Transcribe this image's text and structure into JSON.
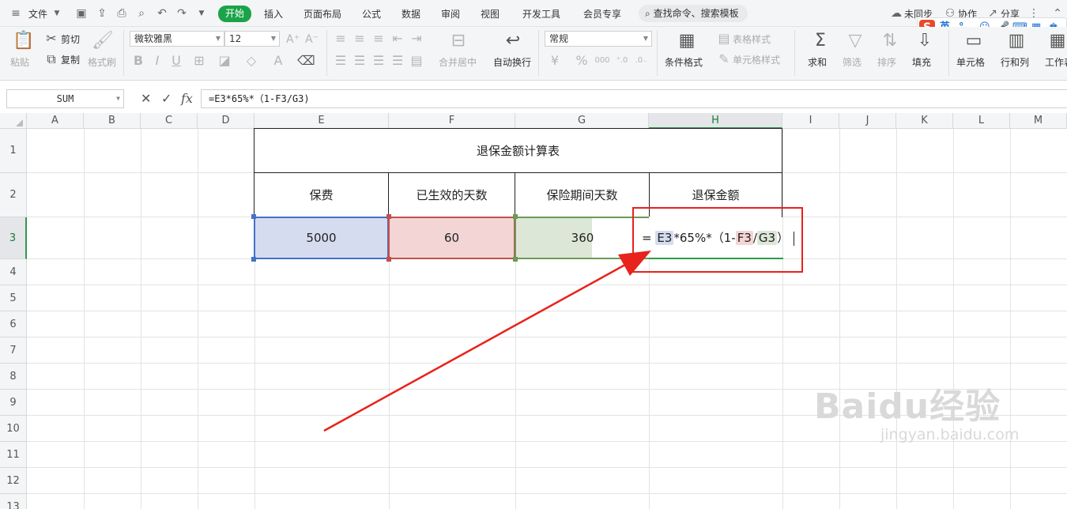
{
  "menu": {
    "file": "文件",
    "tabs": [
      "开始",
      "插入",
      "页面布局",
      "公式",
      "数据",
      "审阅",
      "视图",
      "开发工具",
      "会员专享"
    ],
    "search": "查找命令、搜索模板",
    "right": {
      "sync": "未同步",
      "collab": "协作",
      "share": "分享"
    }
  },
  "ribbon": {
    "paste": "粘贴",
    "cut": "剪切",
    "copy": "复制",
    "format_painter": "格式刷",
    "font_name": "微软雅黑",
    "font_size": "12",
    "merge_center": "合并居中",
    "wrap_text": "自动换行",
    "number_format": "常规",
    "cond_format": "条件格式",
    "table_style": "表格样式",
    "cell_style": "单元格样式",
    "sum": "求和",
    "filter": "筛选",
    "sort": "排序",
    "fill": "填充",
    "cell": "单元格",
    "row_col": "行和列",
    "worksheet": "工作表"
  },
  "ime": {
    "lang": "英"
  },
  "formula_bar": {
    "name_box": "SUM",
    "fx": "fx",
    "formula": "=E3*65%*（1-F3/G3)"
  },
  "columns": [
    "A",
    "B",
    "C",
    "D",
    "E",
    "F",
    "G",
    "H",
    "I",
    "J",
    "K",
    "L",
    "M"
  ],
  "rows": [
    "1",
    "2",
    "3",
    "4",
    "5",
    "6",
    "7",
    "8",
    "9",
    "10",
    "11",
    "12",
    "13"
  ],
  "table": {
    "title": "退保金额计算表",
    "headers": [
      "保费",
      "已生效的天数",
      "保险期间天数",
      "退保金额"
    ],
    "premium": "5000",
    "days_effective": "60",
    "period_days": "360"
  },
  "editing": {
    "eq": "=",
    "ref1": "E3",
    "mid": "*65%*（1-",
    "ref2": "F3",
    "slash": "/",
    "ref3": "G3",
    "end": "）"
  },
  "colors": {
    "accent": "#1ba34a",
    "ref_e3": "#d5dcf0",
    "ref_f3": "#f3d5d5",
    "ref_g3": "#dde7d8",
    "annotation": "#e8221c"
  },
  "watermark": {
    "brand": "Baidu经验",
    "url": "jingyan.baidu.com"
  }
}
